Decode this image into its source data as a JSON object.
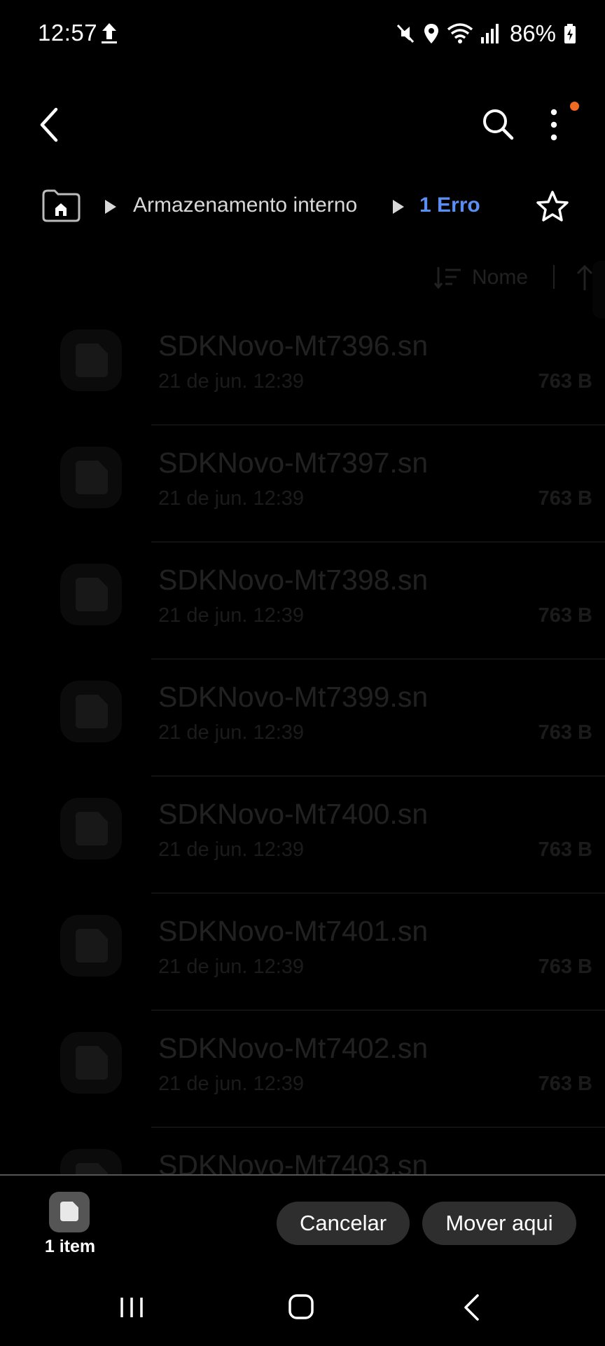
{
  "status_bar": {
    "time": "12:57",
    "battery": "86%",
    "icons": [
      "upload-icon",
      "mute-icon",
      "location-icon",
      "wifi-icon",
      "signal-icon",
      "battery-charging-icon"
    ]
  },
  "top_bar": {
    "icons": [
      "back-icon",
      "search-icon",
      "more-vert-icon"
    ],
    "notification_dot_color": "#f26a21"
  },
  "breadcrumb": {
    "items": [
      "Armazenamento interno",
      "1 Erro"
    ],
    "active_color": "#5b8ef2"
  },
  "sort": {
    "label": "Nome"
  },
  "files": [
    {
      "name": "SDKNovo-Mt7396.sn",
      "date": "21 de jun. 12:39",
      "size": "763 B"
    },
    {
      "name": "SDKNovo-Mt7397.sn",
      "date": "21 de jun. 12:39",
      "size": "763 B"
    },
    {
      "name": "SDKNovo-Mt7398.sn",
      "date": "21 de jun. 12:39",
      "size": "763 B"
    },
    {
      "name": "SDKNovo-Mt7399.sn",
      "date": "21 de jun. 12:39",
      "size": "763 B"
    },
    {
      "name": "SDKNovo-Mt7400.sn",
      "date": "21 de jun. 12:39",
      "size": "763 B"
    },
    {
      "name": "SDKNovo-Mt7401.sn",
      "date": "21 de jun. 12:39",
      "size": "763 B"
    },
    {
      "name": "SDKNovo-Mt7402.sn",
      "date": "21 de jun. 12:39",
      "size": "763 B"
    },
    {
      "name": "SDKNovo-Mt7403.sn",
      "date": "",
      "size": ""
    }
  ],
  "bottom_bar": {
    "selection_count": "1 item",
    "cancel_label": "Cancelar",
    "move_label": "Mover aqui"
  },
  "nav_bar": {
    "icons": [
      "recent-apps-icon",
      "home-icon",
      "back-icon"
    ]
  }
}
